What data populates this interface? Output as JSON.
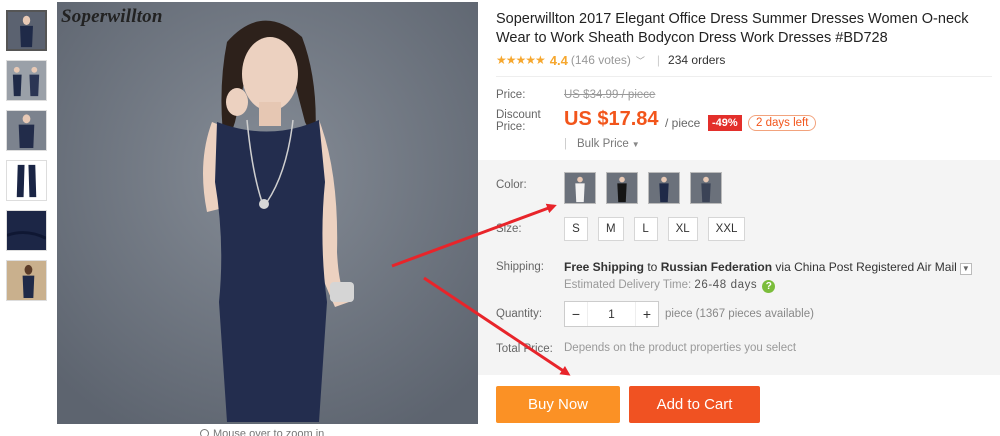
{
  "gallery": {
    "brand": "Soperwillton",
    "zoom_hint": "Mouse over to zoom in",
    "thumbnails": [
      "thumb-1",
      "thumb-2",
      "thumb-3",
      "thumb-4",
      "thumb-5",
      "thumb-6"
    ]
  },
  "product": {
    "title": "Soperwillton 2017 Elegant Office Dress Summer Dresses Women O-neck Wear to Work Sheath Bodycon Dress Work Dresses #BD728",
    "rating": {
      "stars": "★★★★★",
      "score": "4.4",
      "votes": "(146 votes)",
      "orders": "234 orders"
    }
  },
  "price": {
    "label": "Price:",
    "original": "US $34.99 / piece",
    "discount_label_1": "Discount",
    "discount_label_2": "Price:",
    "current": "US $17.84",
    "unit": "/ piece",
    "discount_pct": "-49%",
    "days_left": "2 days left",
    "bulk": "Bulk Price"
  },
  "options": {
    "color_label": "Color:",
    "size_label": "Size:",
    "sizes": [
      "S",
      "M",
      "L",
      "XL",
      "XXL"
    ],
    "shipping_label": "Shipping:",
    "shipping_free": "Free Shipping",
    "shipping_to": " to ",
    "shipping_country": "Russian Federation",
    "shipping_via": " via China Post Registered Air Mail",
    "est_label": "Estimated Delivery Time: ",
    "est_days": "26-48 days",
    "quantity_label": "Quantity:",
    "quantity": "1",
    "pieces": "piece (1367 pieces available)",
    "total_label": "Total Price:",
    "total_note": "Depends on the product properties you select"
  },
  "actions": {
    "buy_now": "Buy Now",
    "add_to_cart": "Add to Cart"
  },
  "colors": {
    "accent": "#f2551b",
    "buy_now": "#fb9125",
    "add_to_cart": "#f05222",
    "star": "#f6a72e",
    "arrow": "#e8242a"
  }
}
